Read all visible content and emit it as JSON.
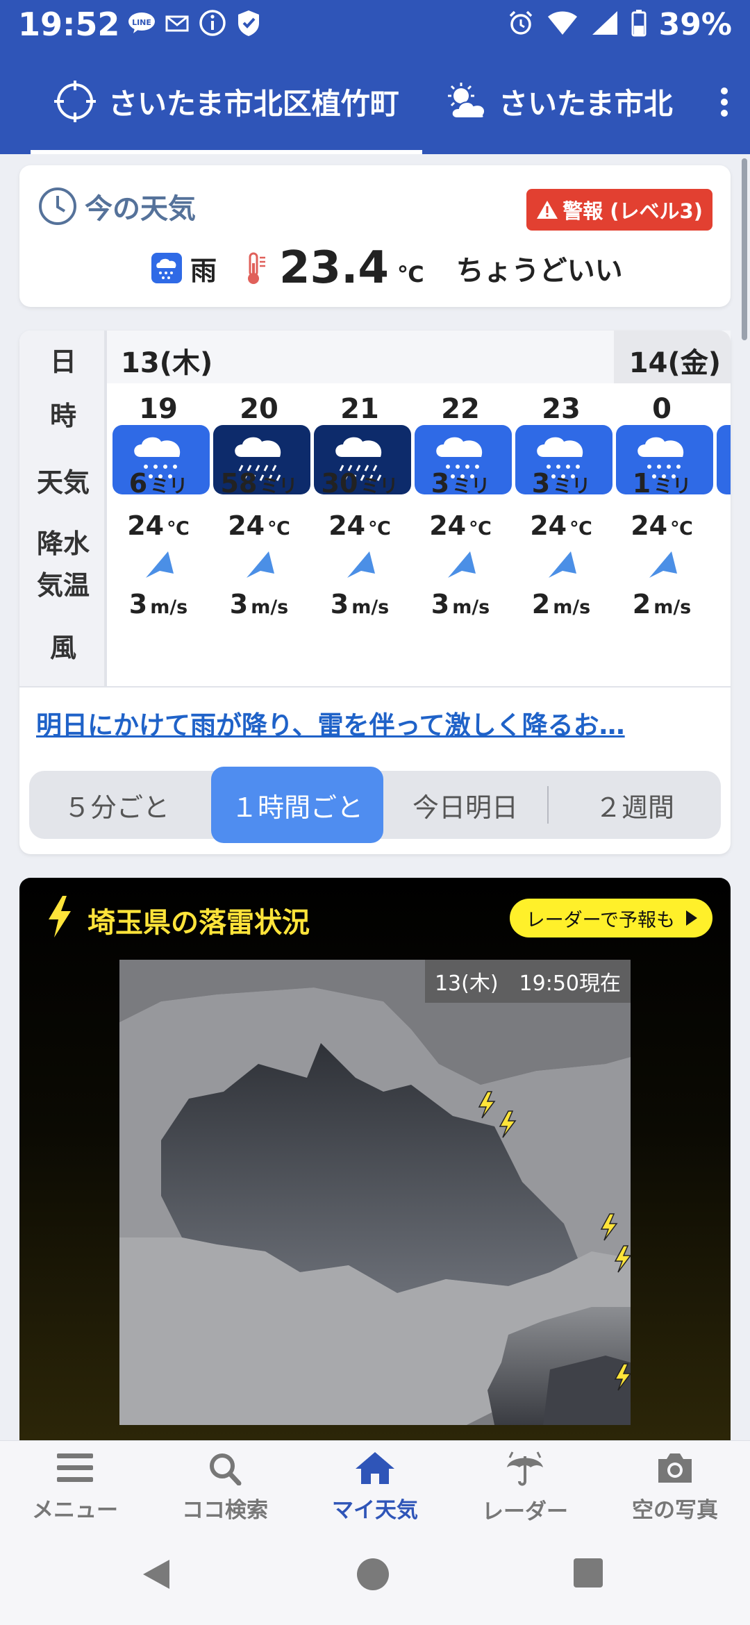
{
  "status_bar": {
    "time": "19:52",
    "battery": "39%"
  },
  "location_tabs": [
    {
      "label": "さいたま市北区植竹町"
    },
    {
      "label": "さいたま市北"
    }
  ],
  "current": {
    "title": "今の天気",
    "warning": "警報 (レベル3)",
    "condition": "雨",
    "temperature": "23.4",
    "temp_unit": "℃",
    "feeling": "ちょうどいい"
  },
  "forecast": {
    "row_labels": {
      "day": "日",
      "hour": "時",
      "weather": "天気",
      "precip": "降水",
      "temp": "気温",
      "wind": "風"
    },
    "days": [
      "13(木)",
      "14(金)"
    ],
    "hours": [
      {
        "hour": "19",
        "weather": "rain",
        "precip": "6",
        "temp": "24",
        "wind": "3"
      },
      {
        "hour": "20",
        "weather": "heavy-rain",
        "precip": "58",
        "temp": "24",
        "wind": "3"
      },
      {
        "hour": "21",
        "weather": "heavy-rain",
        "precip": "30",
        "temp": "24",
        "wind": "3"
      },
      {
        "hour": "22",
        "weather": "rain",
        "precip": "3",
        "temp": "24",
        "wind": "3"
      },
      {
        "hour": "23",
        "weather": "rain",
        "precip": "3",
        "temp": "24",
        "wind": "2"
      },
      {
        "hour": "0",
        "weather": "rain",
        "precip": "1",
        "temp": "24",
        "wind": "2"
      }
    ],
    "precip_unit": "ミリ",
    "temp_unit": "℃",
    "wind_unit": "m/s",
    "link_text": "明日にかけて雨が降り、雷を伴って激しく降るお…",
    "segments": [
      "５分ごと",
      "１時間ごと",
      "今日明日",
      "２週間"
    ],
    "active_segment": "１時間ごと"
  },
  "lightning": {
    "title": "埼玉県の落雷状況",
    "radar_button": "レーダーで予報も",
    "timestamp": "13(木)　19:50現在"
  },
  "bottom_nav": [
    {
      "label": "メニュー",
      "icon": "menu-icon"
    },
    {
      "label": "ココ検索",
      "icon": "search-icon"
    },
    {
      "label": "マイ天気",
      "icon": "home-icon"
    },
    {
      "label": "レーダー",
      "icon": "umbrella-icon"
    },
    {
      "label": "空の写真",
      "icon": "camera-icon"
    }
  ],
  "colors": {
    "header": "#2f55b8",
    "accent": "#4f8df0",
    "warning": "#e24031",
    "lightning_title": "#ffe43a"
  }
}
